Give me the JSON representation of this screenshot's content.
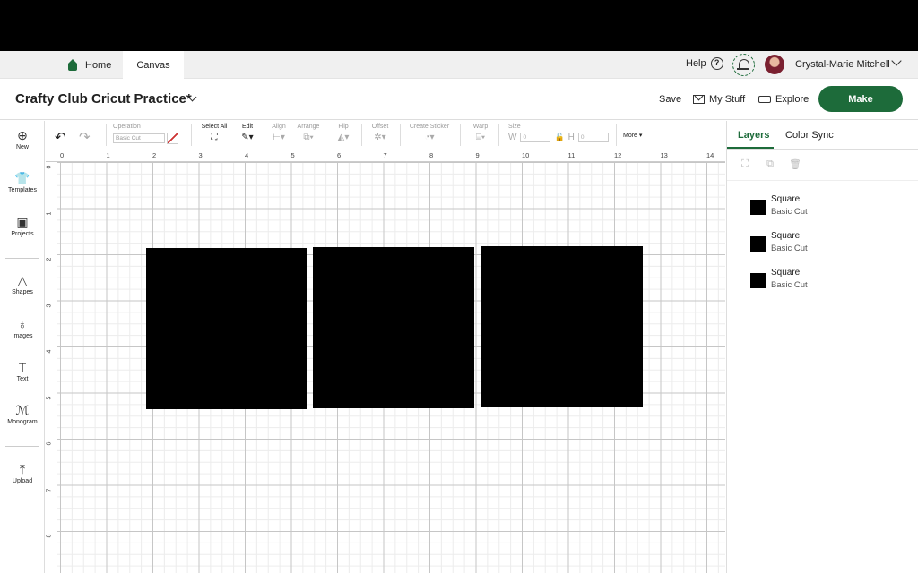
{
  "tabs": {
    "home": "Home",
    "canvas": "Canvas"
  },
  "topbar": {
    "help": "Help",
    "user_name": "Crystal-Marie Mitchell"
  },
  "header": {
    "project_title": "Crafty Club Cricut Practice*",
    "save": "Save",
    "my_stuff": "My Stuff",
    "explore": "Explore",
    "make": "Make"
  },
  "leftbar": [
    {
      "label": "New",
      "icon": "plus-circle-icon"
    },
    {
      "label": "Templates",
      "icon": "tshirt-icon"
    },
    {
      "label": "Projects",
      "icon": "projects-icon"
    },
    {
      "label": "Shapes",
      "icon": "shapes-icon"
    },
    {
      "label": "Images",
      "icon": "lightbulb-icon"
    },
    {
      "label": "Text",
      "icon": "text-icon"
    },
    {
      "label": "Monogram",
      "icon": "monogram-icon"
    },
    {
      "label": "Upload",
      "icon": "upload-icon"
    }
  ],
  "toolbar": {
    "operation_label": "Operation",
    "operation_value": "Basic Cut",
    "select_all": "Select All",
    "edit": "Edit",
    "align": "Align",
    "arrange": "Arrange",
    "flip": "Flip",
    "offset": "Offset",
    "create_sticker": "Create Sticker",
    "warp": "Warp",
    "size": "Size",
    "w_label": "W",
    "w_value": "0",
    "h_label": "H",
    "h_value": "0",
    "more": "More"
  },
  "ruler": {
    "top": [
      "0",
      "1",
      "2",
      "3",
      "4",
      "5",
      "6",
      "7",
      "8",
      "9",
      "10",
      "11",
      "12",
      "13",
      "14"
    ],
    "left": [
      "0",
      "1",
      "2",
      "3",
      "4",
      "5",
      "6",
      "7",
      "8"
    ]
  },
  "right_panel": {
    "tab_layers": "Layers",
    "tab_color_sync": "Color Sync",
    "layers": [
      {
        "name": "Square",
        "operation": "Basic Cut",
        "color": "#000000"
      },
      {
        "name": "Square",
        "operation": "Basic Cut",
        "color": "#000000"
      },
      {
        "name": "Square",
        "operation": "Basic Cut",
        "color": "#000000"
      }
    ]
  },
  "colors": {
    "brand": "#1d6b3a",
    "shape_fill": "#000000"
  }
}
